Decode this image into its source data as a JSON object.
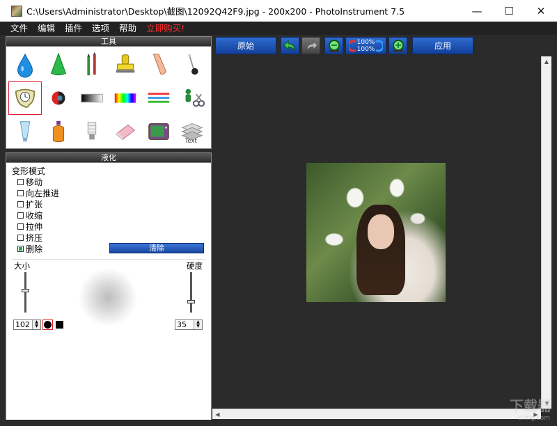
{
  "window": {
    "title": "C:\\Users\\Administrator\\Desktop\\截图\\12092Q42F9.jpg - 200x200 - PhotoInstrument 7.5"
  },
  "menu": {
    "items": [
      "文件",
      "编辑",
      "插件",
      "选项",
      "帮助"
    ],
    "buy": "立即购买!"
  },
  "tools": {
    "title": "工具"
  },
  "liquify": {
    "title": "液化",
    "mode_title": "变形模式",
    "modes": [
      {
        "label": "移动",
        "checked": false
      },
      {
        "label": "向左推进",
        "checked": false
      },
      {
        "label": "扩张",
        "checked": false
      },
      {
        "label": "收缩",
        "checked": false
      },
      {
        "label": "拉伸",
        "checked": false
      },
      {
        "label": "挤压",
        "checked": false
      },
      {
        "label": "删除",
        "checked": true
      }
    ],
    "clear_label": "清除",
    "size_label": "大小",
    "hardness_label": "硬度",
    "size_value": "102",
    "hardness_value": "35",
    "size_level": 0.55,
    "hardness_level": 0.25
  },
  "toolbar": {
    "original_label": "原始",
    "apply_label": "应用",
    "zoom_top": "100%",
    "zoom_bottom": "100%"
  },
  "watermark": {
    "brand": "下载器",
    "site": "d.ttlg.com"
  },
  "colors": {
    "accent_blue": "#1646a0",
    "buy_red": "#ff2b2b",
    "canvas_bg": "#2b2b2b"
  }
}
